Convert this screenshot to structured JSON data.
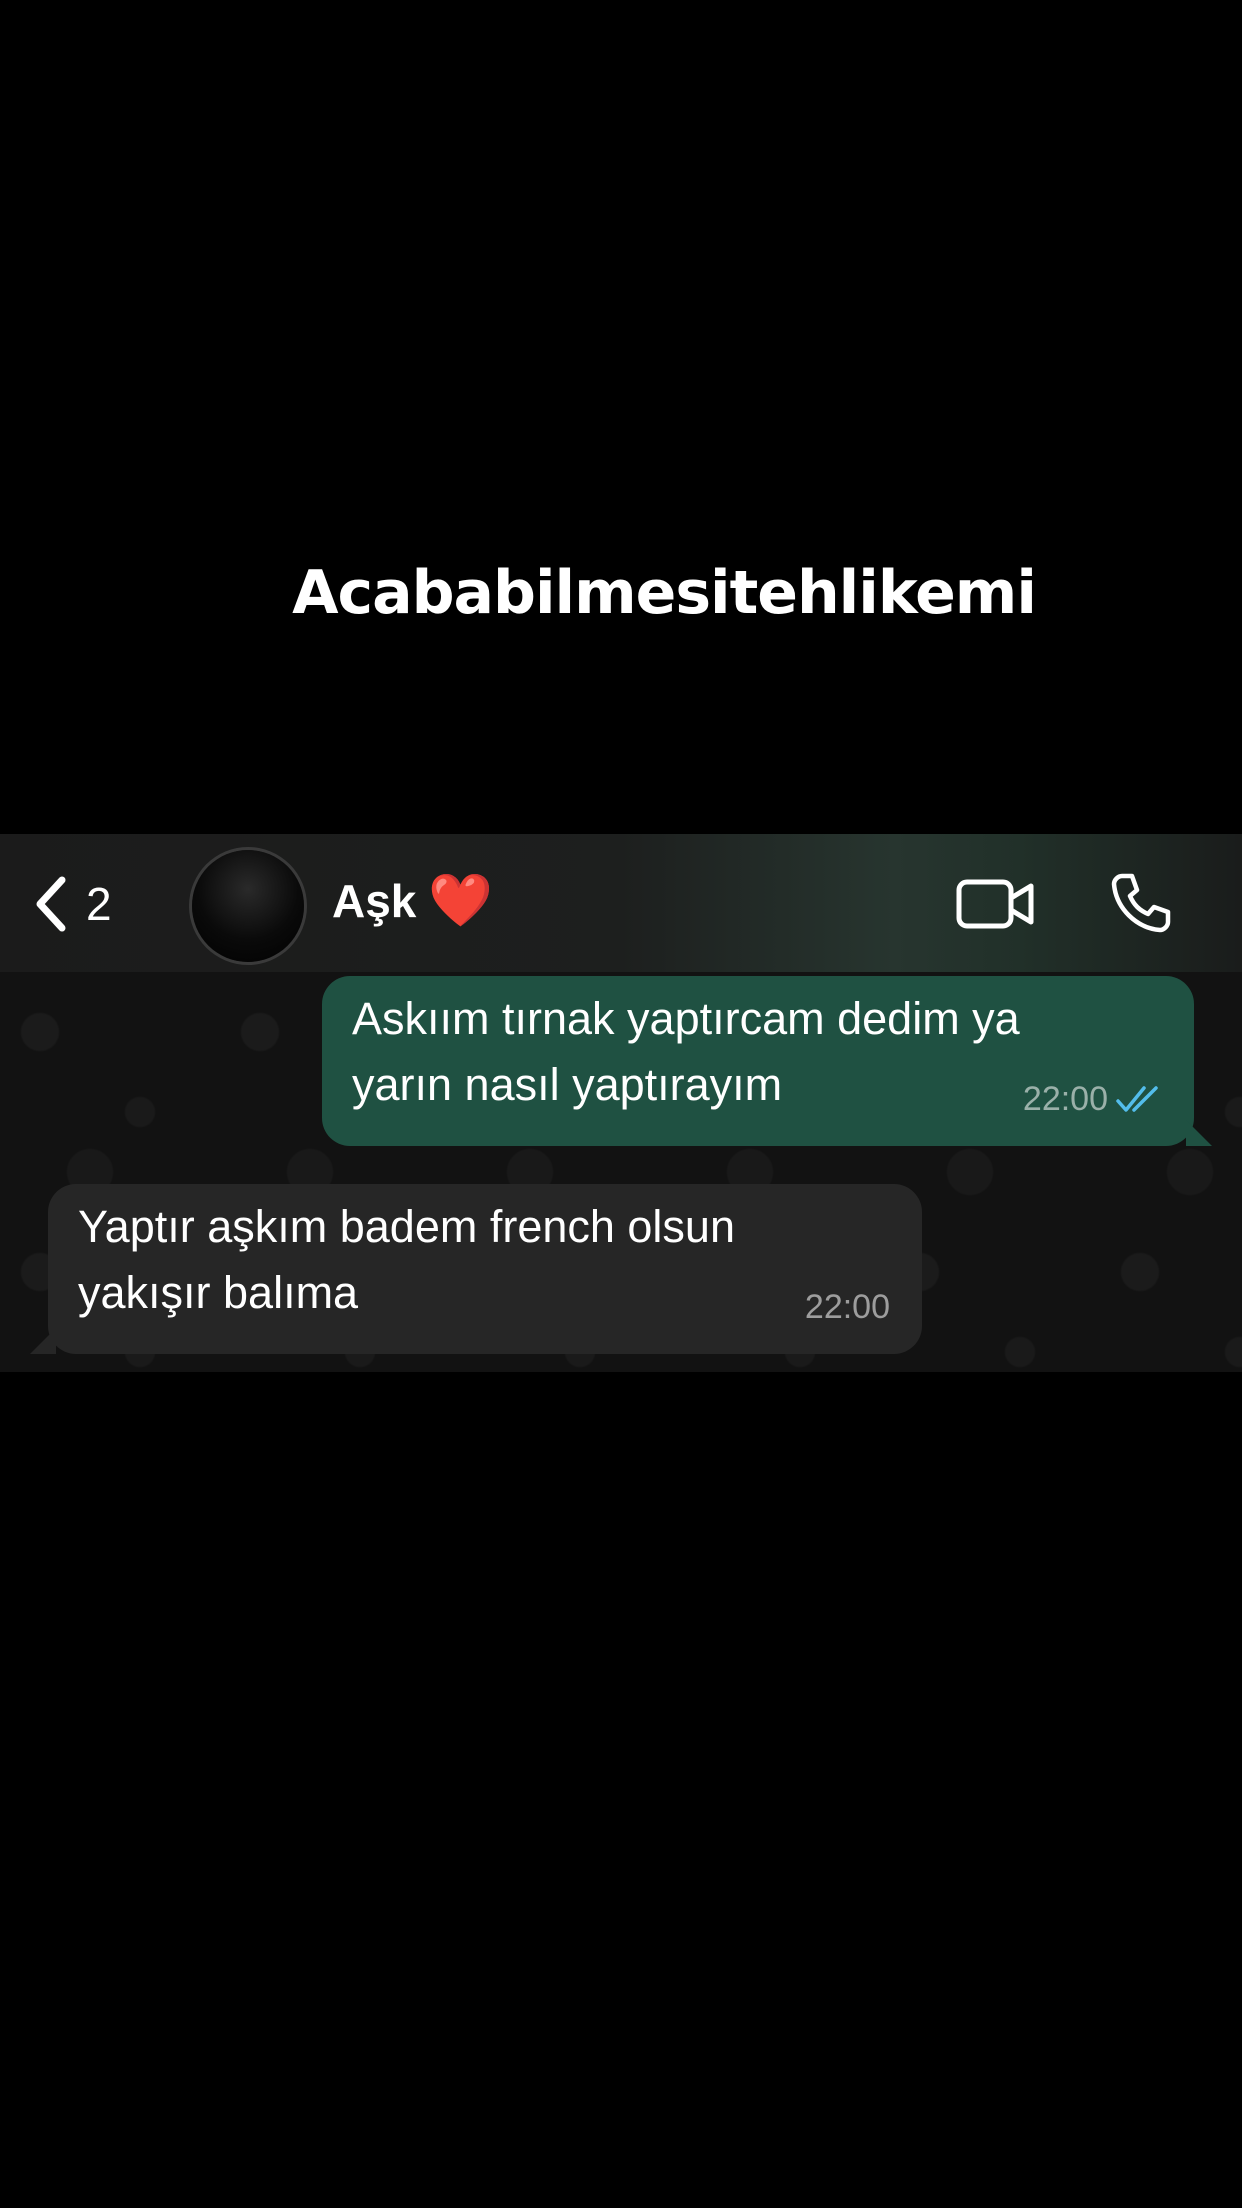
{
  "overlay_caption": "Acababilmesitehlikemi",
  "header": {
    "back_count": "2",
    "contact_name": "Aşk",
    "contact_emoji": "❤️",
    "icons": [
      "back-chevron-icon",
      "video-camera-icon",
      "phone-icon"
    ]
  },
  "messages": [
    {
      "direction": "outgoing",
      "text": "Askıım tırnak yaptırcam dedim ya\nyarın nasıl yaptırayım",
      "time": "22:00",
      "status": "read"
    },
    {
      "direction": "incoming",
      "text": "Yaptır aşkım badem french olsun\nyakışır balıma",
      "time": "22:00"
    }
  ],
  "colors": {
    "background": "#000000",
    "outgoing_bubble": "#1f5142",
    "incoming_bubble": "#262626",
    "read_ticks": "#53bdeb"
  }
}
